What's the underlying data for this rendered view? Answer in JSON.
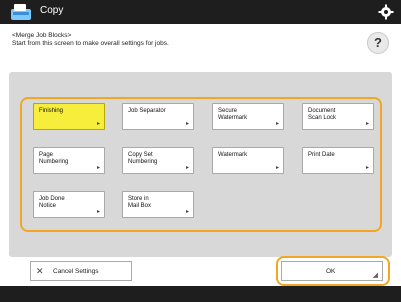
{
  "window": {
    "title": "Copy"
  },
  "instructions": {
    "line1": "<Merge Job Blocks>",
    "line2": "Start from this screen to make overall settings for jobs."
  },
  "help": {
    "label": "?"
  },
  "functions": [
    {
      "label": "Finishing",
      "selected": true
    },
    {
      "label": "Job Separator",
      "selected": false
    },
    {
      "label": "Secure\nWatermark",
      "selected": false
    },
    {
      "label": "Document\nScan Lock",
      "selected": false
    },
    {
      "label": "Page\nNumbering",
      "selected": false
    },
    {
      "label": "Copy Set\nNumbering",
      "selected": false
    },
    {
      "label": "Watermark",
      "selected": false
    },
    {
      "label": "Print Date",
      "selected": false
    },
    {
      "label": "Job Done\nNotice",
      "selected": false
    },
    {
      "label": "Store in\nMail Box",
      "selected": false
    }
  ],
  "footer": {
    "cancel_label": "Cancel Settings",
    "ok_label": "OK"
  },
  "colors": {
    "selected": "#f6ee3b",
    "highlight": "#f2a724",
    "titlebar": "#1e1e1e"
  }
}
